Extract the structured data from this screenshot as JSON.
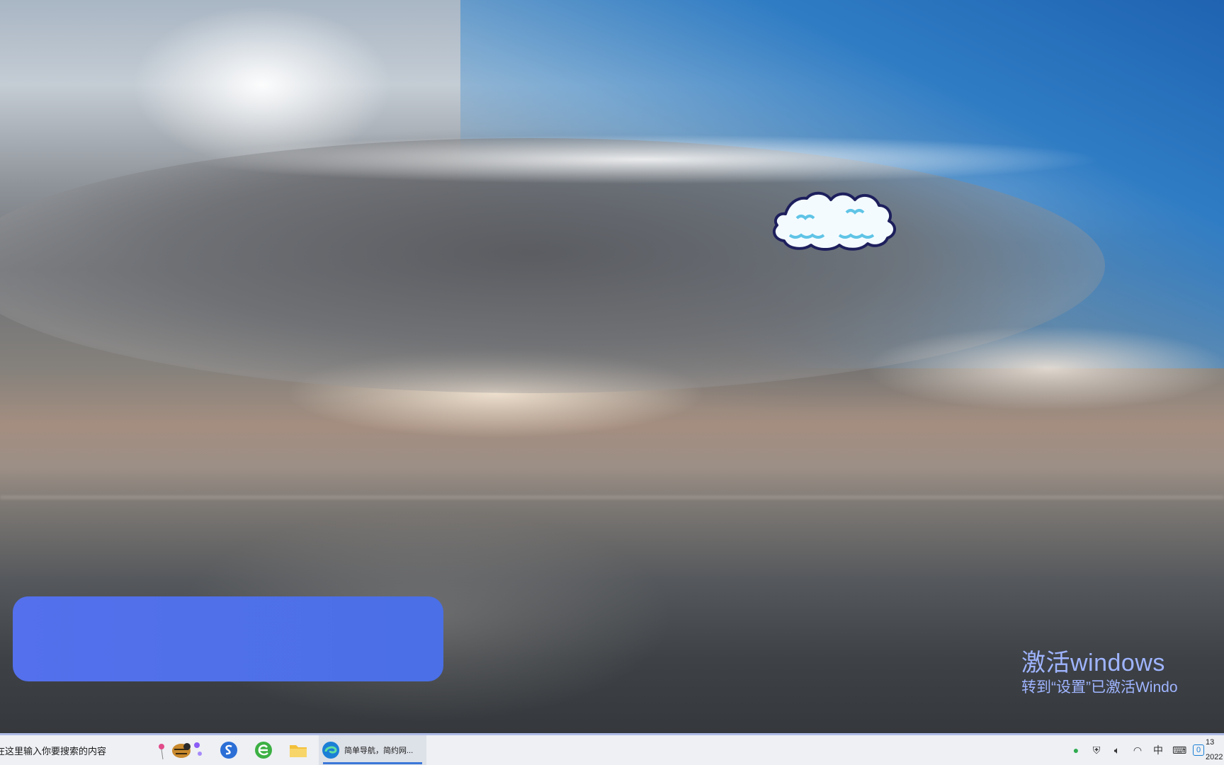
{
  "desktop": {
    "activation_title": "激活windows",
    "activation_subtitle": "转到“设置”已激活Windo"
  },
  "taskbar": {
    "search_placeholder": "在这里输入你要搜索的内容",
    "pinned_apps": [
      {
        "name": "sogou-browser",
        "icon": "s-swirl-icon"
      },
      {
        "name": "360-browser",
        "icon": "green-e-icon"
      },
      {
        "name": "file-explorer",
        "icon": "folder-icon"
      }
    ],
    "edge_window_label": "简单导航，简约网...",
    "tray": {
      "ime_label": "中",
      "notification_count": "0"
    },
    "clock_time": "13",
    "clock_date": "2022"
  },
  "colors": {
    "panel_blue": "#4a6fe6",
    "activation_text": "#9fb4ff",
    "taskbar_bg": "#eef0f4",
    "accent": "#3b77d8"
  }
}
